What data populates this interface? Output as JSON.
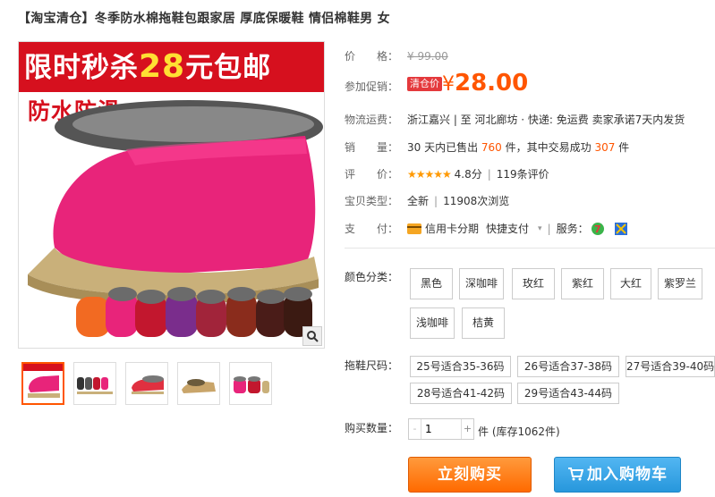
{
  "title": "【淘宝清仓】冬季防水棉拖鞋包跟家居 厚底保暖鞋 情侣棉鞋男 女",
  "image": {
    "banner_prefix": "限时秒杀",
    "banner_num": "28",
    "banner_suffix": "元包邮",
    "slogan": "防水防滑"
  },
  "price": {
    "label": "价　　格：",
    "original": "¥ 99.00"
  },
  "promo": {
    "label": "参加促销：",
    "tag": "清仓价",
    "symbol": "¥",
    "value": "28.00"
  },
  "shipping": {
    "label": "物流运费：",
    "text": "浙江嘉兴 | 至  河北廊坊 ·   快递: 免运费    卖家承诺7天内发货"
  },
  "sales": {
    "label": "销　　量：",
    "prefix": "30 天内已售出 ",
    "sold": "760",
    "mid": " 件，其中交易成功 ",
    "success": "307",
    "suffix": " 件"
  },
  "rating": {
    "label": "评　　价：",
    "stars": "★★★★★",
    "score": "4.8分",
    "reviews": "119条评价"
  },
  "type": {
    "label": "宝贝类型：",
    "condition": "全新",
    "views": "11908次浏览"
  },
  "payment": {
    "label": "支　　付：",
    "credit": "信用卡分期",
    "quick": "快捷支付",
    "service_label": "服务："
  },
  "colors": {
    "label": "颜色分类：",
    "options": [
      "黑色",
      "深咖啡",
      "玫红",
      "紫红",
      "大红",
      "紫罗兰",
      "浅咖啡",
      "桔黄"
    ]
  },
  "sizes": {
    "label": "拖鞋尺码：",
    "options": [
      "25号适合35-36码",
      "26号适合37-38码",
      "27号适合39-40码",
      "28号适合41-42码",
      "29号适合43-44码"
    ]
  },
  "quantity": {
    "label": "购买数量：",
    "value": "1",
    "stock": "件 (库存1062件)"
  },
  "buttons": {
    "buy": "立刻购买",
    "cart": "加入购物车"
  },
  "colors_theme": {
    "accent": "#ff5500",
    "buy": "#ff7a1a",
    "cart": "#3aa6e8",
    "promo_red": "#e4393c"
  }
}
